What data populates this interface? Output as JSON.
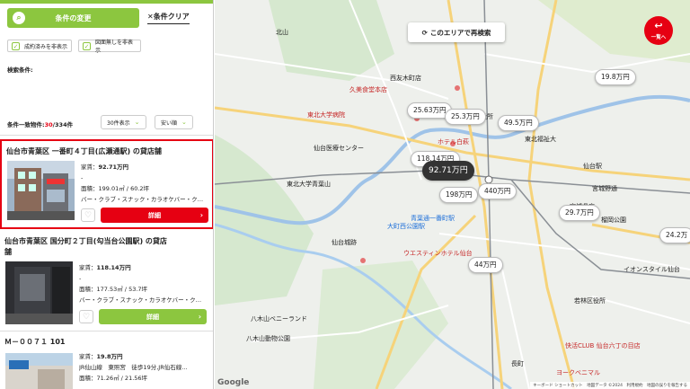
{
  "sidebar": {
    "change_button": "条件の変更",
    "clear_button": "条件クリア",
    "hide_contracted": "成約済みを非表示",
    "hide_no_plan": "図面無しを非表示",
    "search_conditions_label": "検索条件:",
    "hits_prefix": "条件一致物件:",
    "hits_count": "30",
    "hits_total": "/334件",
    "per_page": "30件表示",
    "sort": "安い順"
  },
  "listings": [
    {
      "title": "仙台市青葉区 一番町４丁目(広瀬通駅) の貸店舗",
      "rent_label": "家賃：",
      "rent": "92.71万円",
      "dash": "-",
      "area": "面積：199.01㎡ / 60.2坪",
      "tags": "バー・クラブ・スナック・カラオケバー・ク…",
      "detail": "詳細"
    },
    {
      "title_line1": "仙台市青葉区 国分町２丁目(勾当台公園駅) の貸店",
      "title_line2": "舗",
      "rent_label": "家賃：",
      "rent": "118.14万円",
      "dash": "-",
      "area": "面積：177.53㎡ / 53.7坪",
      "tags": "バー・クラブ・スナック・カラオケバー・ク…",
      "detail": "詳細"
    },
    {
      "title": "Ｍ－００７１ 101",
      "rent_label": "家賃：",
      "rent": "19.8万円",
      "access": "JR仙山線　東照宮　徒歩19分,JR仙石線…",
      "area": "面積：71.26㎡ / 21.56坪"
    }
  ],
  "map": {
    "research_button": "このエリアで再検索",
    "back_button": "一覧へ",
    "price_badges": [
      "19.8万円",
      "25.63万円",
      "25.3万円",
      "49.5万円",
      "118.14万円",
      "92.71万円",
      "198万円",
      "440万円",
      "29.7万円",
      "24.2万",
      "44万円"
    ],
    "place_labels": [
      "仙台医療センター",
      "東北大学病院",
      "ホテル白萩",
      "仙台市役所",
      "東北福祉大",
      "久美食堂本店",
      "北山",
      "西友木町店",
      "東北大学青葉山",
      "青葉通一番町駅",
      "大町西公園駅",
      "宮城県庁",
      "ウエスティンホテル仙台",
      "八木山ベニーランド",
      "八木山動物公園",
      "仙台城跡",
      "榴岡公園",
      "仙台駅",
      "宮城野通",
      "イオンスタイル仙台",
      "若林区役所",
      "快活CLUB 仙台六丁の目店",
      "長町",
      "ヨークベニマル"
    ],
    "attribution": "キーボード ショートカット　地図データ ©2024　利用規約　地図の誤りを報告する",
    "google": "Google"
  },
  "colors": {
    "accent": "#8cc63f",
    "red": "#e60012"
  }
}
